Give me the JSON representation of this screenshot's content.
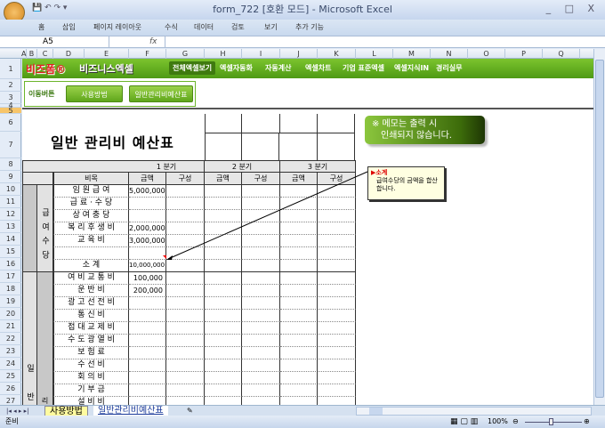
{
  "window": {
    "title": "form_722  [호환 모드] - Microsoft Excel",
    "controls": "_ □ X"
  },
  "menu": [
    "홈",
    "삽입",
    "페이지 레이아웃",
    "수식",
    "데이터",
    "검토",
    "보기",
    "추가 기능"
  ],
  "formula_bar": {
    "name_box": "A5",
    "fx": "fx",
    "value": ""
  },
  "columns": [
    "A",
    "B",
    "C",
    "D",
    "E",
    "F",
    "G",
    "H",
    "I",
    "J",
    "K",
    "L",
    "M",
    "N",
    "O",
    "P",
    "Q"
  ],
  "rows": [
    "1",
    "2",
    "3",
    "4",
    "5",
    "6",
    "7",
    "8",
    "9",
    "10",
    "11",
    "12",
    "13",
    "14",
    "15",
    "16",
    "17",
    "18",
    "19",
    "20",
    "21",
    "22",
    "23",
    "24",
    "25",
    "26",
    "27"
  ],
  "banner": {
    "logo1": "비즈폼®",
    "logo2": "비즈니스엑셀",
    "nav": [
      "전체엑셀보기",
      "엑셀자동화",
      "자동계산",
      "엑셀차트",
      "기업 표준엑셀",
      "엑셀지식IN",
      "경리실무"
    ],
    "active": "전체엑셀보기"
  },
  "navbox": {
    "label": "이동버튼",
    "buttons": [
      "사용방법",
      "일반관리비예산표"
    ]
  },
  "sheet": {
    "title": "일반 관리비 예산표",
    "quarters": [
      "1 분기",
      "2 분기",
      "3 분기"
    ],
    "item_header": "비목",
    "sub_headers": [
      "금액",
      "구성"
    ],
    "group1": "급 여 수 당",
    "group2": "일 반 관",
    "group2_sub": "리",
    "items": [
      {
        "name": "임 원 급 여",
        "q1": "5,000,000"
      },
      {
        "name": "급 료 · 수 당",
        "q1": ""
      },
      {
        "name": "상 여 충 당",
        "q1": ""
      },
      {
        "name": "복 리 후 생 비",
        "q1": "2,000,000"
      },
      {
        "name": "교   육   비",
        "q1": "3,000,000"
      },
      {
        "name": "",
        "q1": ""
      },
      {
        "name": "소          계",
        "q1": "10,000,000"
      },
      {
        "name": "여 비 교 통 비",
        "q1": "100,000"
      },
      {
        "name": "운   반   비",
        "q1": "200,000"
      },
      {
        "name": "광 고 선 전 비",
        "q1": ""
      },
      {
        "name": "통   신   비",
        "q1": ""
      },
      {
        "name": "접 대 교 제 비",
        "q1": ""
      },
      {
        "name": "수 도 광 열 비",
        "q1": ""
      },
      {
        "name": "보   험   료",
        "q1": ""
      },
      {
        "name": "수   선   비",
        "q1": ""
      },
      {
        "name": "회   의   비",
        "q1": ""
      },
      {
        "name": "기   부   금",
        "q1": ""
      },
      {
        "name": "설   비   비",
        "q1": ""
      }
    ]
  },
  "memo": {
    "line1": "※ 메모는 출력 시",
    "line2": "인쇄되지 않습니다."
  },
  "comment": {
    "title": "▶소계",
    "body": "급여수당의 금액을 합산합니다."
  },
  "tabs": [
    "사용방법",
    "일반관리비예산표"
  ],
  "status": {
    "ready": "준비",
    "zoom": "100%"
  }
}
